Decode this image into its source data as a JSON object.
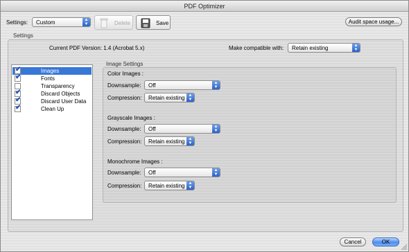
{
  "window": {
    "title": "PDF Optimizer"
  },
  "toolbar": {
    "settings_label": "Settings:",
    "settings_value": "Custom",
    "delete_label": "Delete",
    "save_label": "Save",
    "audit_label": "Audit space usage..."
  },
  "settings_group": {
    "title": "Settings",
    "current_version": "Current PDF Version: 1.4 (Acrobat 5.x)",
    "compat_label": "Make compatible with:",
    "compat_value": "Retain existing"
  },
  "panels": [
    {
      "label": "Images",
      "checked": true,
      "selected": true
    },
    {
      "label": "Fonts",
      "checked": true,
      "selected": false
    },
    {
      "label": "Transparency",
      "checked": false,
      "selected": false
    },
    {
      "label": "Discard Objects",
      "checked": true,
      "selected": false
    },
    {
      "label": "Discard User Data",
      "checked": true,
      "selected": false
    },
    {
      "label": "Clean Up",
      "checked": true,
      "selected": false
    }
  ],
  "image_settings": {
    "title": "Image Settings",
    "downsample_label": "Downsample:",
    "compression_label": "Compression:",
    "color": {
      "heading": "Color Images :",
      "downsample": "Off",
      "compression": "Retain existing"
    },
    "grayscale": {
      "heading": "Grayscale Images :",
      "downsample": "Off",
      "compression": "Retain existing"
    },
    "mono": {
      "heading": "Monochrome Images :",
      "downsample": "Off",
      "compression": "Retain existing"
    }
  },
  "footer": {
    "cancel_label": "Cancel",
    "ok_label": "OK"
  },
  "colors": {
    "accent": "#3977d7",
    "check": "#1d4fb8"
  }
}
